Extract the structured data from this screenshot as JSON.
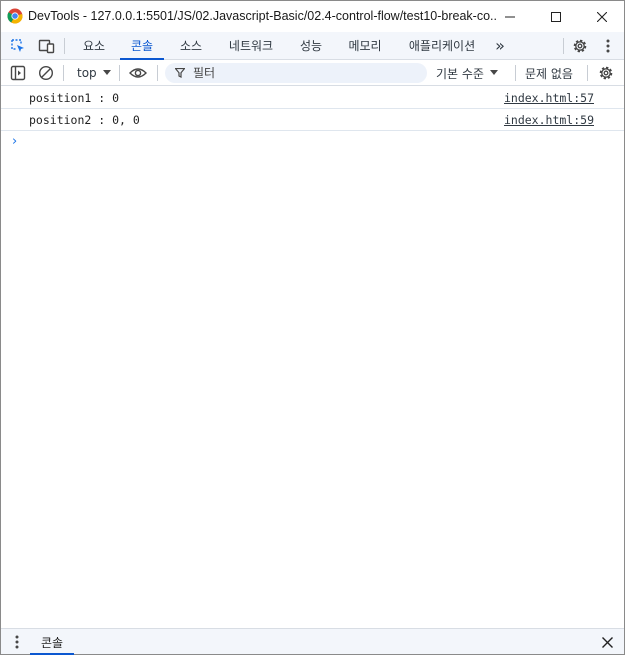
{
  "window": {
    "title": "DevTools - 127.0.0.1:5501/JS/02.Javascript-Basic/02.4-control-flow/test10-break-co...",
    "icons": {
      "app": "chrome-icon",
      "minimize": "minimize-icon",
      "maximize": "maximize-icon",
      "close": "close-icon"
    }
  },
  "tabbar": {
    "tabs": [
      {
        "label": "요소",
        "active": false
      },
      {
        "label": "콘솔",
        "active": true
      },
      {
        "label": "소스",
        "active": false
      },
      {
        "label": "네트워크",
        "active": false
      },
      {
        "label": "성능",
        "active": false
      },
      {
        "label": "메모리",
        "active": false
      },
      {
        "label": "애플리케이션",
        "active": false
      }
    ],
    "more_label": "»",
    "icons": {
      "inspect": "inspect-element-icon",
      "device": "device-toolbar-icon",
      "settings": "gear-icon",
      "menu": "kebab-menu-icon"
    }
  },
  "console_toolbar": {
    "context": "top",
    "filter_placeholder": "필터",
    "levels": "기본 수준",
    "issues": "문제 없음"
  },
  "messages": [
    {
      "text": "position1 : 0",
      "source": "index.html:57"
    },
    {
      "text": "position2 : 0, 0",
      "source": "index.html:59"
    }
  ],
  "prompt": "›",
  "drawer": {
    "tab": "콘솔"
  },
  "colors": {
    "accent": "#0b57d0",
    "toolbar_bg": "#f3f6fb",
    "filter_bg": "#edf2fa"
  }
}
